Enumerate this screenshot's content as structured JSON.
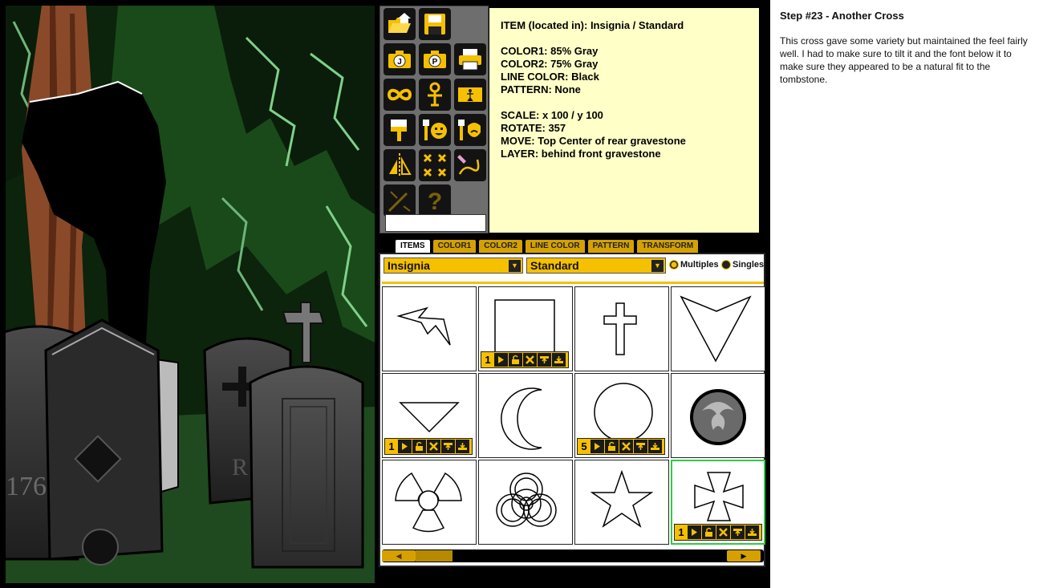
{
  "toolbar": {
    "tools": [
      {
        "name": "open-icon"
      },
      {
        "name": "save-icon"
      },
      {
        "name": "export-j-icon",
        "label": "J"
      },
      {
        "name": "export-p-icon",
        "label": "P"
      },
      {
        "name": "print-icon"
      },
      {
        "name": "infinity-icon"
      },
      {
        "name": "key-figure-icon"
      },
      {
        "name": "layer-figure-icon"
      },
      {
        "name": "paint-brush-icon"
      },
      {
        "name": "face-brush-icon"
      },
      {
        "name": "beard-brush-icon"
      },
      {
        "name": "flip-icon"
      },
      {
        "name": "delete-all-icon"
      },
      {
        "name": "pencil-draw-icon"
      },
      {
        "name": "magic-icon"
      },
      {
        "name": "help-icon",
        "label": "?"
      }
    ]
  },
  "info": {
    "item": "ITEM (located in): Insignia / Standard",
    "color1": "COLOR1: 85% Gray",
    "color2": "COLOR2: 75% Gray",
    "line_color": "LINE COLOR: Black",
    "pattern": "PATTERN: None",
    "scale": "SCALE: x 100 / y 100",
    "rotate": "ROTATE: 357",
    "move": "MOVE: Top Center of rear gravestone",
    "layer": "LAYER: behind front gravestone"
  },
  "tabs": [
    {
      "label": "ITEMS",
      "active": true
    },
    {
      "label": "COLOR1",
      "active": false
    },
    {
      "label": "COLOR2",
      "active": false
    },
    {
      "label": "LINE COLOR",
      "active": false
    },
    {
      "label": "PATTERN",
      "active": false
    },
    {
      "label": "TRANSFORM",
      "active": false
    }
  ],
  "items_panel": {
    "category": "Insignia",
    "subcategory": "Standard",
    "multiples_label": "Multiples",
    "singles_label": "Singles",
    "cells": [
      {
        "name": "lightning-bolt",
        "count": null
      },
      {
        "name": "square",
        "count": "1"
      },
      {
        "name": "cross",
        "count": null
      },
      {
        "name": "chevron-shield",
        "count": null
      },
      {
        "name": "triangle-down",
        "count": "1"
      },
      {
        "name": "crescent-moon",
        "count": null
      },
      {
        "name": "circle",
        "count": "5"
      },
      {
        "name": "eagle-medallion",
        "count": null
      },
      {
        "name": "radiation-symbol",
        "count": null
      },
      {
        "name": "biohazard-symbol",
        "count": null
      },
      {
        "name": "star",
        "count": null
      },
      {
        "name": "iron-cross",
        "count": "1",
        "selected": true
      }
    ]
  },
  "step": {
    "title": "Step #23 - Another Cross",
    "body": "This cross gave some variety but maintained the feel fairly well. I had to make sure to tilt it and the font below it to make sure they appeared to be a natural fit to the tombstone."
  },
  "colors": {
    "accent": "#f5c000",
    "note_bg": "#ffffc8",
    "selected_border": "#2ecc40"
  }
}
